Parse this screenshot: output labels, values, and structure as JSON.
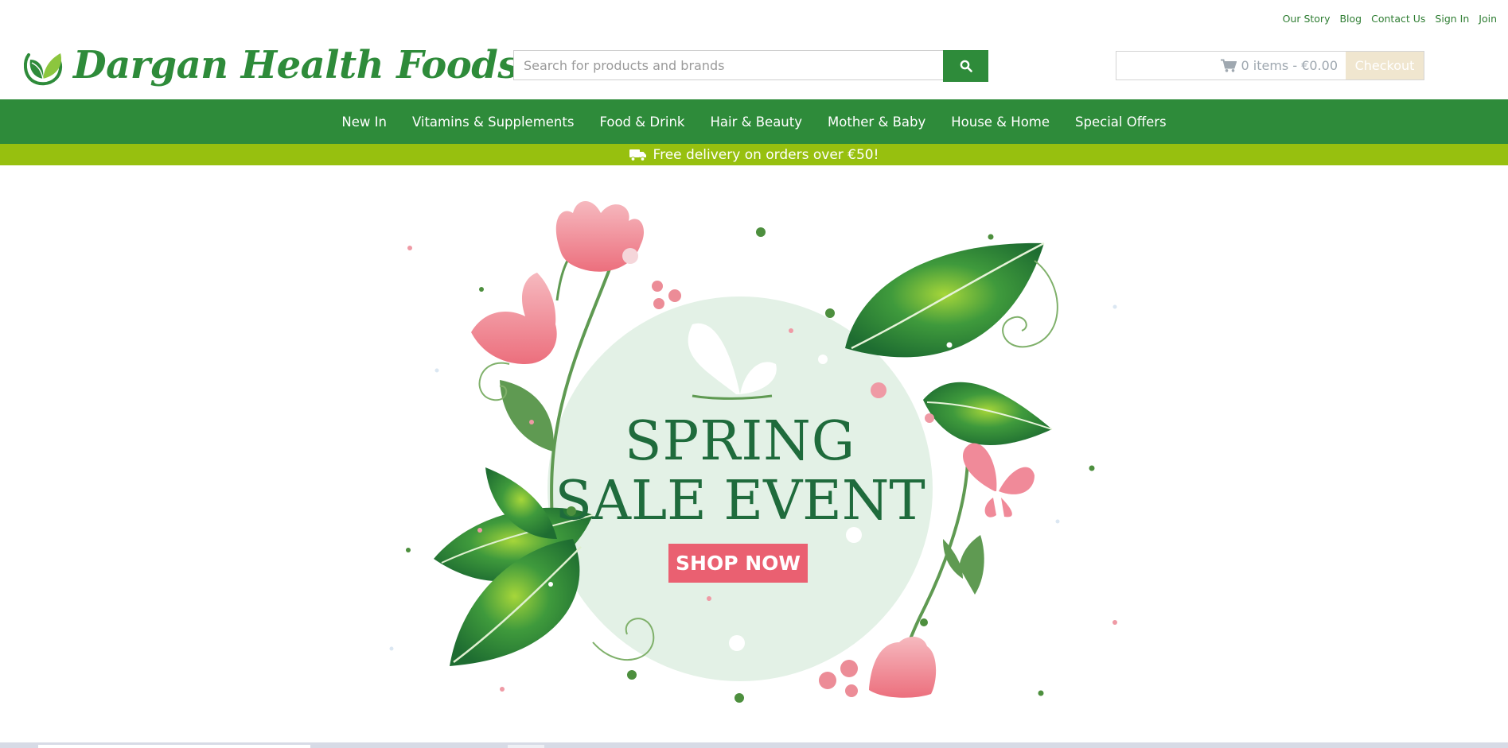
{
  "utility_links": [
    "Our Story",
    "Blog",
    "Contact Us",
    "Sign In",
    "Join"
  ],
  "logo": {
    "text": "Dargan Health Foods"
  },
  "search": {
    "placeholder": "Search for products and brands",
    "button_icon": "search-icon"
  },
  "cart": {
    "summary": "0 items - €0.00",
    "icon": "shopping-cart-icon",
    "checkout_label": "Checkout"
  },
  "nav": [
    "New In",
    "Vitamins & Supplements",
    "Food & Drink",
    "Hair & Beauty",
    "Mother & Baby",
    "House & Home",
    "Special Offers"
  ],
  "delivery": {
    "text": "Free delivery on orders over €50!",
    "icon": "delivery-truck-icon"
  },
  "hero": {
    "line1": "SPRING",
    "line2": "SALE EVENT",
    "cta": "SHOP NOW"
  },
  "colors": {
    "brand_green": "#2e8b3a",
    "banner_lime": "#97c00f",
    "cta_pink": "#ea6071",
    "circle_mint": "#e3f1e6",
    "checkout_bg": "#f0e6cf"
  }
}
